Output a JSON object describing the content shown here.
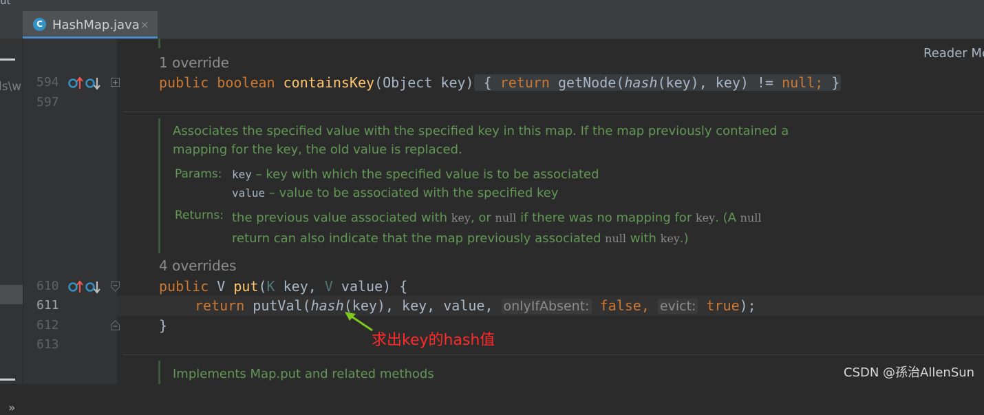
{
  "window": {
    "top_text": "ut",
    "left_path": "ls\\w"
  },
  "tab": {
    "icon": "C",
    "label": "HashMap.java",
    "close": "×"
  },
  "reader_mode": "Reader Mo",
  "gutter": {
    "lines": [
      "594",
      "597",
      "610",
      "611",
      "612",
      "613"
    ]
  },
  "code": {
    "override1": "1 override",
    "containsKey": {
      "public": "public",
      "boolean": "boolean",
      "name": "containsKey",
      "params": "(Object key)",
      "open": " { ",
      "return": "return",
      "getNode": " getNode(",
      "hash": "hash",
      "rest": "(key), key) != ",
      "null": "null;",
      "close": " }"
    },
    "doc_put": {
      "line1": "Associates the specified value with the specified key in this map. If the map previously contained a",
      "line2": "mapping for the key, the old value is replaced.",
      "params_label": "Params:",
      "param1_name": "key",
      "param1_desc": " – key with which the specified value is to be associated",
      "param2_name": "value",
      "param2_desc": " – value to be associated with the specified key",
      "returns_label": "Returns:",
      "ret_a": "the previous value associated with ",
      "ret_key1": "key",
      "ret_b": ", or ",
      "ret_null1": "null",
      "ret_c": " if there was no mapping for ",
      "ret_key2": "key",
      "ret_d": ". (A ",
      "ret_null2": "null",
      "ret2_a": "return can also indicate that the map previously associated ",
      "ret2_null": "null",
      "ret2_b": " with ",
      "ret2_key": "key",
      "ret2_c": ".)"
    },
    "override2": "4 overrides",
    "put_sig": {
      "public": "public",
      "V": " V ",
      "name": "put",
      "lp": "(",
      "K": "K",
      "key": " key, ",
      "V2": "V",
      "value": " value) {"
    },
    "put_body": {
      "return": "return",
      "putVal": " putVal(",
      "hash": "hash",
      "args": "(key), key, value, ",
      "hint1": "onlyIfAbsent:",
      "false": "false,",
      "hint2": "evict:",
      "true": "true",
      "end": ");"
    },
    "close_brace": "}",
    "doc_putval": "Implements Map.put and related methods"
  },
  "annotation": "求出key的hash值",
  "watermark": "CSDN @孫治AllenSun",
  "colors": {
    "keyword": "#cc7832",
    "method": "#ffc66d",
    "doc": "#629755",
    "annotation": "#ff2a2a",
    "arrow": "#7ec81d"
  }
}
